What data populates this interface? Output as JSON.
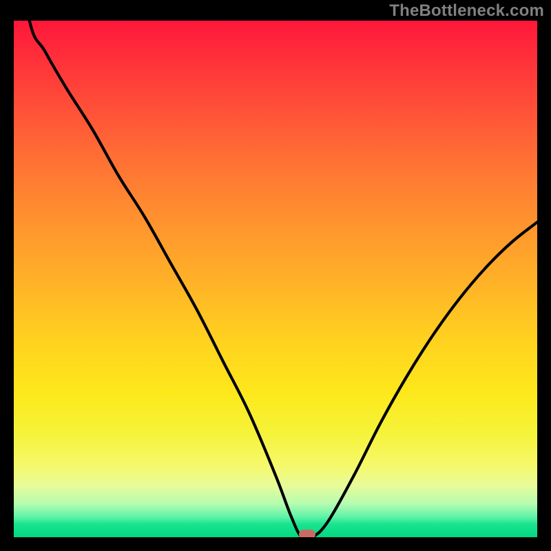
{
  "attribution": "TheBottleneck.com",
  "colors": {
    "frame": "#000000",
    "curve": "#000000",
    "marker": "#cb6a60",
    "attribution_text": "#808080"
  },
  "chart_data": {
    "type": "line",
    "title": "",
    "xlabel": "",
    "ylabel": "",
    "xlim": [
      0,
      100
    ],
    "ylim": [
      0,
      100
    ],
    "x": [
      0,
      3,
      6,
      10,
      15,
      20,
      25,
      30,
      35,
      40,
      45,
      50,
      53,
      55,
      57,
      60,
      65,
      70,
      75,
      80,
      85,
      90,
      95,
      100
    ],
    "values": [
      120,
      100,
      94,
      87,
      79,
      70,
      62,
      53,
      44,
      34,
      24,
      12,
      4,
      0,
      0,
      3,
      12,
      22,
      31,
      39,
      46,
      52,
      57,
      61
    ],
    "minimum": {
      "x": 56,
      "y": 0
    },
    "series": [
      {
        "name": "bottleneck-curve",
        "values": [
          120,
          100,
          94,
          87,
          79,
          70,
          62,
          53,
          44,
          34,
          24,
          12,
          4,
          0,
          0,
          3,
          12,
          22,
          31,
          39,
          46,
          52,
          57,
          61
        ]
      }
    ]
  }
}
